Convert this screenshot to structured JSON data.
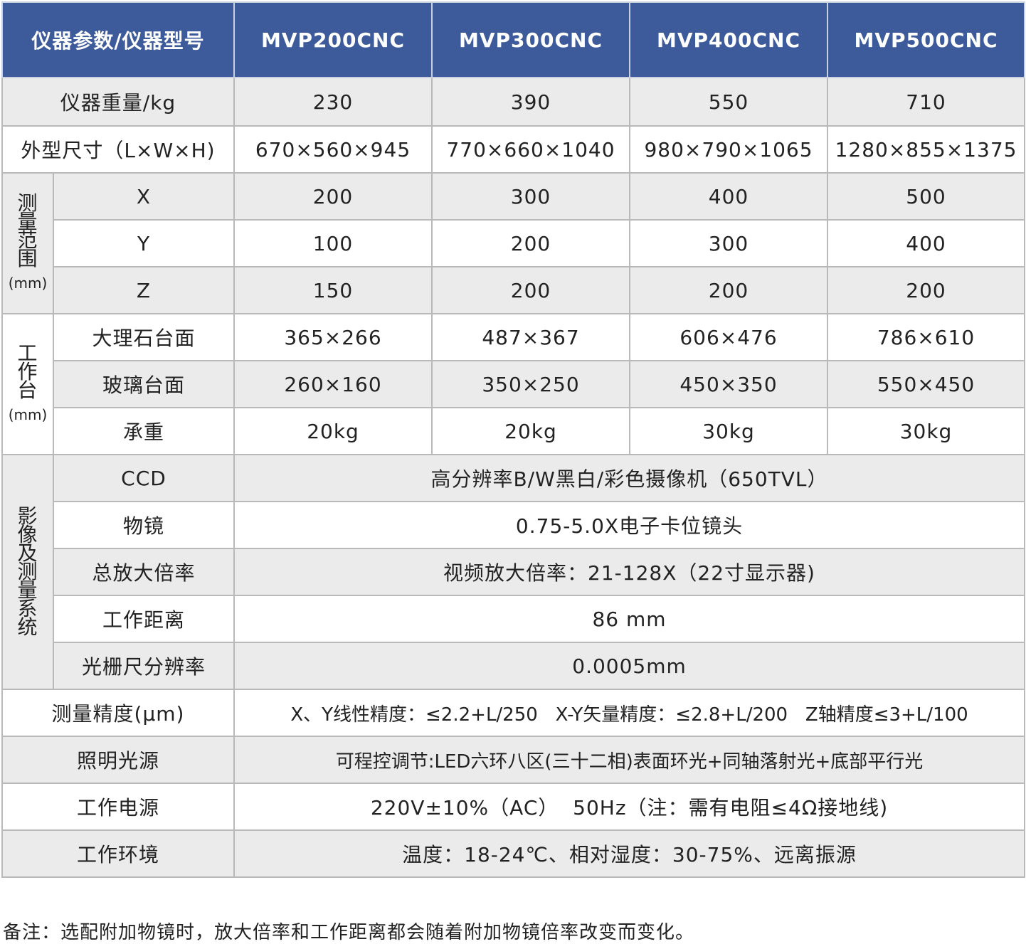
{
  "header": {
    "label": "仪器参数/仪器型号",
    "models": [
      "MVP200CNC",
      "MVP300CNC",
      "MVP400CNC",
      "MVP500CNC"
    ]
  },
  "rows": {
    "weight": {
      "label": "仪器重量/kg",
      "values": [
        "230",
        "390",
        "550",
        "710"
      ]
    },
    "size": {
      "label": "外型尺寸（L×W×H)",
      "values": [
        "670×560×945",
        "770×660×1040",
        "980×790×1065",
        "1280×855×1375"
      ]
    },
    "range": {
      "group": "测量范围",
      "unit": "(mm)",
      "x": {
        "label": "X",
        "values": [
          "200",
          "300",
          "400",
          "500"
        ]
      },
      "y": {
        "label": "Y",
        "values": [
          "100",
          "200",
          "300",
          "400"
        ]
      },
      "z": {
        "label": "Z",
        "values": [
          "150",
          "200",
          "200",
          "200"
        ]
      }
    },
    "stage": {
      "group": "工作台",
      "unit": "(mm)",
      "marble": {
        "label": "大理石台面",
        "values": [
          "365×266",
          "487×367",
          "606×476",
          "786×610"
        ]
      },
      "glass": {
        "label": "玻璃台面",
        "values": [
          "260×160",
          "350×250",
          "450×350",
          "550×450"
        ]
      },
      "load": {
        "label": "承重",
        "values": [
          "20kg",
          "20kg",
          "30kg",
          "30kg"
        ]
      }
    },
    "imaging": {
      "group": "影像及测量系统",
      "ccd": {
        "label": "CCD",
        "value": "高分辨率B/W黑白/彩色摄像机（650TVL）"
      },
      "objective": {
        "label": "物镜",
        "value": "0.75-5.0X电子卡位镜头"
      },
      "magnification": {
        "label": "总放大倍率",
        "value": "视频放大倍率：21-128X（22寸显示器)"
      },
      "distance": {
        "label": "工作距离",
        "value": "86 mm"
      },
      "grating": {
        "label": "光栅尺分辨率",
        "value": "0.0005mm"
      }
    },
    "accuracy": {
      "label": "测量精度(μm)",
      "value": "X、Y线性精度：≤2.2+L/250   X-Y矢量精度：≤2.8+L/200   Z轴精度≤3+L/100"
    },
    "lighting": {
      "label": "照明光源",
      "value": "可程控调节:LED六环八区(三十二相)表面环光+同轴落射光+底部平行光"
    },
    "power": {
      "label": "工作电源",
      "value": "220V±10%（AC）  50Hz（注：需有电阻≤4Ω接地线)"
    },
    "environment": {
      "label": "工作环境",
      "value": "温度：18-24℃、相对湿度：30-75%、远离振源"
    }
  },
  "note": "备注：选配附加物镜时，放大倍率和工作距离都会随着附加物镜倍率改变而变化。",
  "colors": {
    "header_bg": "#3d5a9b",
    "row_gray": "#ebebeb",
    "border": "#b9b9b9"
  }
}
